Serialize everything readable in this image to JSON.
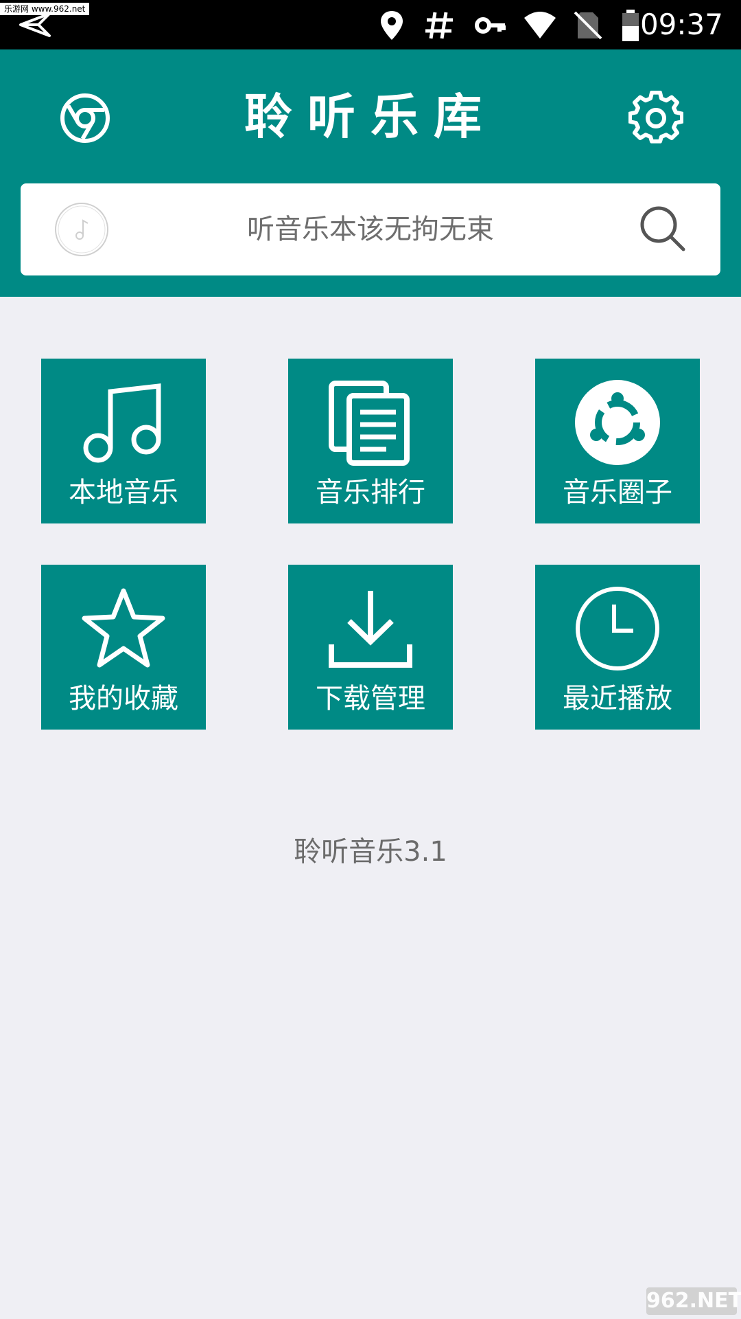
{
  "status_bar": {
    "watermark": "乐游网 www.962.net",
    "time": "09:37",
    "icons": [
      "send-icon",
      "location-icon",
      "hash-icon",
      "key-icon",
      "wifi-icon",
      "no-sim-icon",
      "battery-icon"
    ]
  },
  "header": {
    "title": "聆听乐库",
    "left_icon": "chrome-icon",
    "right_icon": "gear-icon"
  },
  "search": {
    "placeholder": "听音乐本该无拘无束",
    "left_icon": "music-disc-icon",
    "right_icon": "search-icon"
  },
  "tiles": [
    {
      "label": "本地音乐",
      "icon": "music-note-icon"
    },
    {
      "label": "音乐排行",
      "icon": "copy-document-icon"
    },
    {
      "label": "音乐圈子",
      "icon": "ubuntu-circle-icon"
    },
    {
      "label": "我的收藏",
      "icon": "star-icon"
    },
    {
      "label": "下载管理",
      "icon": "download-icon"
    },
    {
      "label": "最近播放",
      "icon": "clock-icon"
    }
  ],
  "footer": {
    "version": "聆听音乐3.1",
    "watermark": "962.NET"
  },
  "colors": {
    "primary": "#008a85",
    "background": "#efeff4",
    "status_bar": "#000000"
  }
}
